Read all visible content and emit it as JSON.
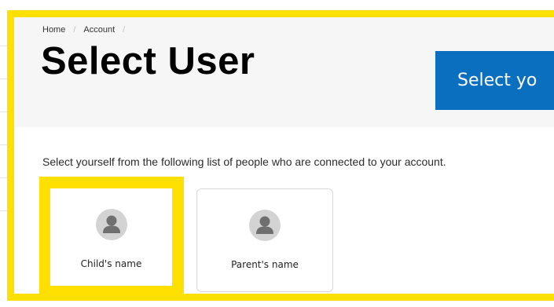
{
  "breadcrumb": [
    {
      "label": "Home"
    },
    {
      "label": "Account"
    }
  ],
  "breadcrumb_separator": "/",
  "page_title": "Select User",
  "banner": {
    "text": "Select yo",
    "color": "#0a6fbf"
  },
  "instructions": "Select yourself from the following list of people who are connected to your account.",
  "users": [
    {
      "name": "Child's name",
      "icon": "user-avatar-icon",
      "highlighted": true
    },
    {
      "name": "Parent's name",
      "icon": "user-avatar-icon",
      "highlighted": false
    }
  ],
  "colors": {
    "highlight": "#ffe000",
    "header_background": "#f6f6f6",
    "avatar_background": "#d3d3d3",
    "avatar_silhouette": "#6f6f6f"
  }
}
